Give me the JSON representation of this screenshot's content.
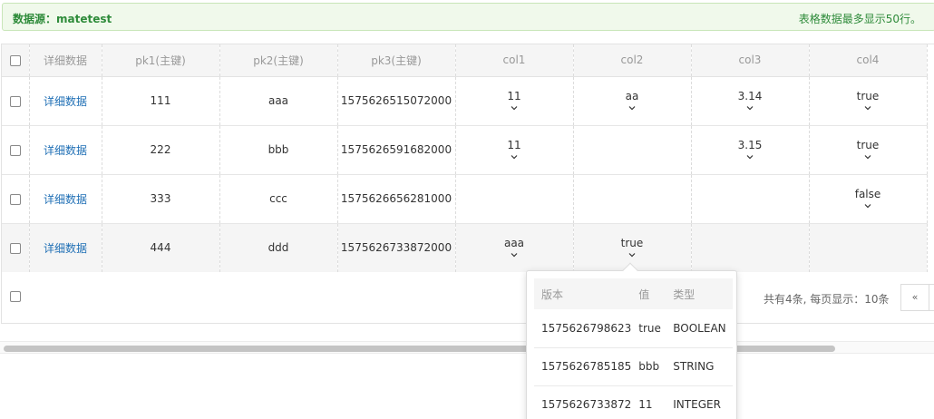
{
  "banner": {
    "datasource": "数据源：matetest",
    "limit_note": "表格数据最多显示50行。"
  },
  "table": {
    "headers": [
      "详细数据",
      "pk1(主键)",
      "pk2(主键)",
      "pk3(主键)",
      "col1",
      "col2",
      "col3",
      "col4"
    ],
    "rows": [
      {
        "detail": "详细数据",
        "pk1": "111",
        "pk2": "aaa",
        "pk3": "1575626515072000",
        "col1": "11",
        "col2": "aa",
        "col3": "3.14",
        "col4": "true"
      },
      {
        "detail": "详细数据",
        "pk1": "222",
        "pk2": "bbb",
        "pk3": "1575626591682000",
        "col1": "11",
        "col2": "",
        "col3": "3.15",
        "col4": "true"
      },
      {
        "detail": "详细数据",
        "pk1": "333",
        "pk2": "ccc",
        "pk3": "1575626656281000",
        "col1": "",
        "col2": "",
        "col3": "",
        "col4": "false"
      },
      {
        "detail": "详细数据",
        "pk1": "444",
        "pk2": "ddd",
        "pk3": "1575626733872000",
        "col1": "aaa",
        "col2": "true",
        "col3": "",
        "col4": ""
      }
    ]
  },
  "pager": {
    "summary": "共有4条, 每页显示：10条",
    "first_label": "«"
  },
  "popover": {
    "headers": [
      "版本",
      "值",
      "类型"
    ],
    "rows": [
      {
        "version": "1575626798623",
        "value": "true",
        "type": "BOOLEAN"
      },
      {
        "version": "1575626785185",
        "value": "bbb",
        "type": "STRING"
      },
      {
        "version": "1575626733872",
        "value": "11",
        "type": "INTEGER"
      }
    ]
  },
  "icons": {
    "expand": "chevron-down-icon",
    "checkbox": "checkbox-icon"
  }
}
